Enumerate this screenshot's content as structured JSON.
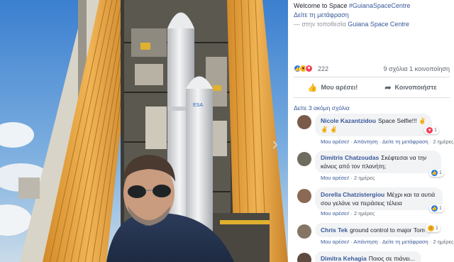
{
  "post": {
    "text_prefix": "Welcome to Space ",
    "hashtag": "#GuianaSpaceCentre",
    "translate_link": "Δείτε τη μετάφραση",
    "location_prefix": "— στην τοποθεσία ",
    "location": "Guiana Space Centre"
  },
  "stats": {
    "reaction_count": "222",
    "comments_shares": "9 σχόλια   1 κοινοποίηση"
  },
  "actions": {
    "like": "Μου αρέσει!",
    "share": "Κοινοποιήστε"
  },
  "more_comments": "Δείτε 3 ακόμη σχόλια",
  "comments": [
    {
      "author": "Nicole Kazantzidou",
      "text": "Space Selfie!!! ✌",
      "text2": "✌ ✌",
      "like": "Μου αρέσει!",
      "reply": "Απάντηση",
      "translate": "Δείτε τη μετάφραση",
      "time": "2 ημέρες",
      "reactions": "1",
      "reaction_kind": "love",
      "avatar_color": "#7a5a48"
    },
    {
      "author": "Dimitris Chatzoudas",
      "text": "Σκέφτεσαι να την",
      "text2": "κάνεις από τον πλανήτη;",
      "like": "Μου αρέσει!",
      "time": "2 ημέρες",
      "reactions": "1",
      "reaction_kind": "like",
      "avatar_color": "#6f6b5e"
    },
    {
      "author": "Dorella Chatzistergiou",
      "text": "Μέχρι και τα αυτιά",
      "text2": "σου γελάνε να περάσεις τέλεια",
      "like": "Μου αρέσει!",
      "time": "2 ημέρες",
      "reactions": "1",
      "reaction_kind": "like",
      "avatar_color": "#8a6a55"
    },
    {
      "author": "Chris Tek",
      "text": "ground control to major Tom",
      "like": "Μου αρέσει!",
      "reply": "Απάντηση",
      "translate": "Δείτε τη μετάφραση",
      "time": "2 ημέρες",
      "reactions": "1",
      "reaction_kind": "haha",
      "avatar_color": "#857565"
    },
    {
      "author": "Dimitra Kehagia",
      "text": "Ποιος σε πιάνει...",
      "avatar_color": "#5e4a3e"
    }
  ],
  "colors": {
    "link": "#365899",
    "like_blue": "#1877f2",
    "love_red": "#f33e58",
    "haha_yellow": "#f7b125",
    "bubble_bg": "#f2f3f5",
    "photo_bg": "#000000"
  },
  "icons": [
    "thumbs-up-icon",
    "share-arrow-icon",
    "chevron-right-icon"
  ]
}
